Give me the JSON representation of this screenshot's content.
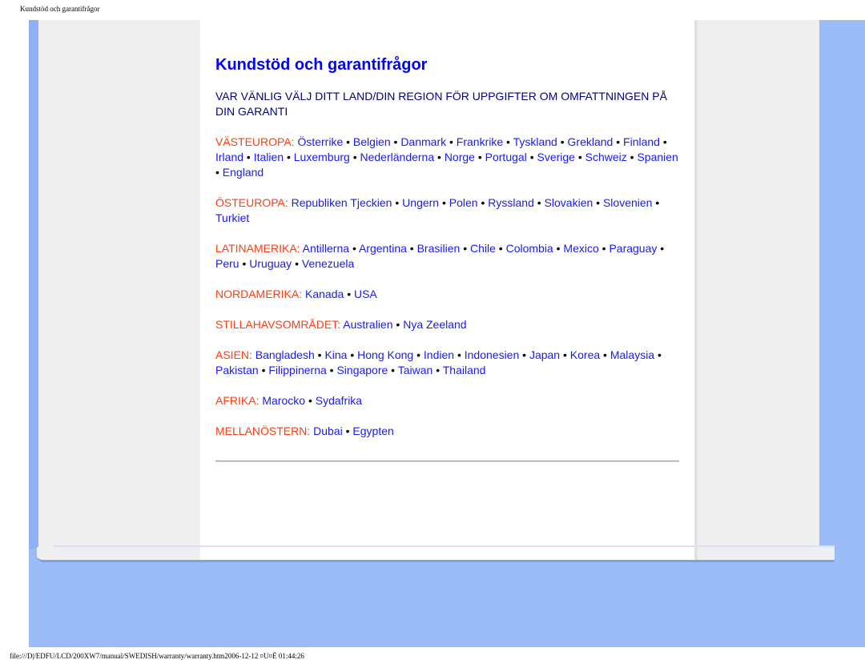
{
  "page_header": "Kundstöd och garantifrågor",
  "footer": "file:///D|/EDFU/LCD/200XW7/manual/SWEDISH/warranty/warranty.htm2006-12-12 ¤U¤È 01:44:26",
  "title": "Kundstöd och garantifrågor",
  "intro": "VAR VÄNLIG VÄLJ DITT LAND/DIN REGION FÖR UPPGIFTER OM OMFATTNINGEN PÅ DIN GARANTI",
  "separator": "•",
  "colors": {
    "title": "#0000ff",
    "intro": "#000080",
    "region_label": "#ff3c14",
    "link": "#1a1aee",
    "background": "#9bbcf7"
  },
  "regions": [
    {
      "label": "VÄSTEUROPA:",
      "countries": [
        "Österrike",
        "Belgien",
        "Danmark",
        "Frankrike",
        "Tyskland",
        "Grekland",
        "Finland",
        "Irland",
        "Italien",
        "Luxemburg",
        "Nederländerna",
        "Norge",
        "Portugal",
        "Sverige",
        "Schweiz",
        "Spanien",
        "England"
      ]
    },
    {
      "label": "ÖSTEUROPA:",
      "countries": [
        "Republiken Tjeckien",
        "Ungern",
        "Polen",
        "Ryssland",
        "Slovakien",
        "Slovenien",
        "Turkiet"
      ]
    },
    {
      "label": "LATINAMERIKA:",
      "countries": [
        "Antillerna",
        "Argentina",
        "Brasilien",
        "Chile",
        "Colombia",
        "Mexico",
        "Paraguay",
        "Peru",
        "Uruguay",
        "Venezuela"
      ]
    },
    {
      "label": "NORDAMERIKA:",
      "countries": [
        "Kanada",
        "USA"
      ]
    },
    {
      "label": "STILLAHAVSOMRÅDET:",
      "countries": [
        "Australien",
        "Nya Zeeland"
      ]
    },
    {
      "label": "ASIEN:",
      "countries": [
        "Bangladesh",
        "Kina",
        "Hong Kong",
        "Indien",
        "Indonesien",
        "Japan",
        "Korea",
        "Malaysia",
        "Pakistan",
        "Filippinerna",
        "Singapore",
        "Taiwan",
        "Thailand"
      ]
    },
    {
      "label": "AFRIKA:",
      "countries": [
        "Marocko",
        "Sydafrika"
      ]
    },
    {
      "label": "MELLANÖSTERN:",
      "countries": [
        "Dubai",
        "Egypten"
      ]
    }
  ]
}
